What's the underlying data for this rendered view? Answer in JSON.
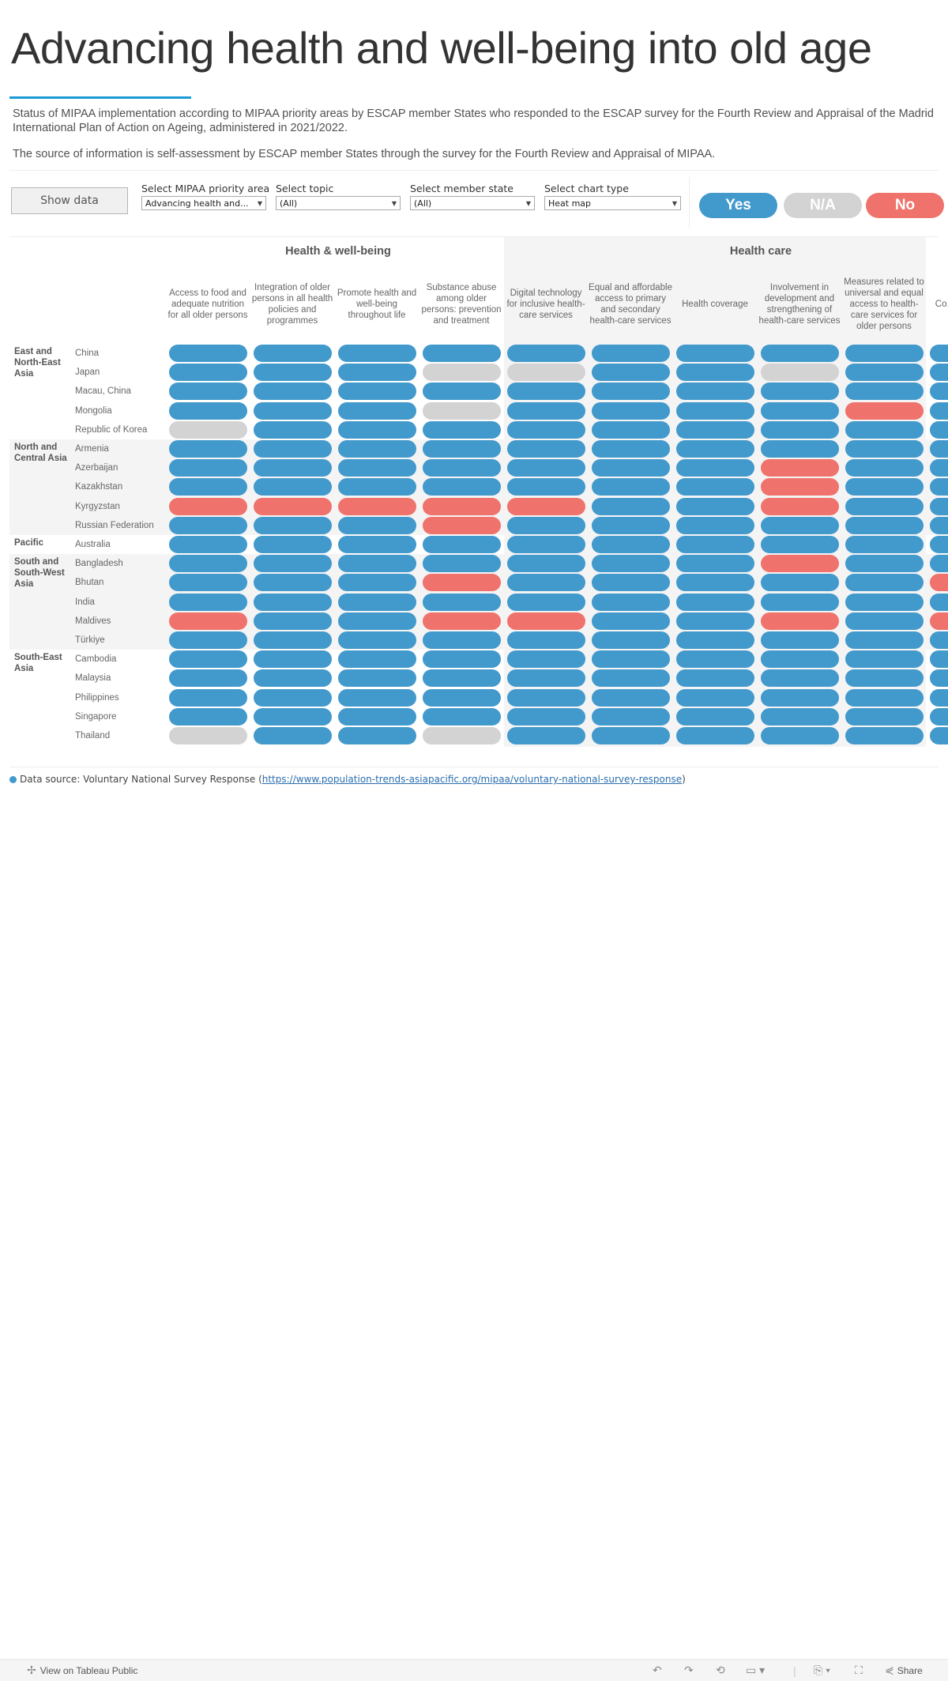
{
  "header": {
    "title": "Advancing health and well-being into old age",
    "description_1": "Status of MIPAA implementation according to MIPAA priority areas by ESCAP member States who responded to the ESCAP survey for the Fourth Review and Appraisal of the Madrid International Plan of Action on Ageing, administered in 2021/2022.",
    "description_2": "The source of information is self-assessment by ESCAP member States through the survey for the Fourth Review and Appraisal of MIPAA."
  },
  "controls": {
    "show_data_label": "Show data",
    "filters": [
      {
        "label": "Select MIPAA priority area",
        "value": "Advancing health and..."
      },
      {
        "label": "Select topic",
        "value": "(All)"
      },
      {
        "label": "Select member state",
        "value": "(All)"
      },
      {
        "label": "Select chart type",
        "value": "Heat map"
      }
    ],
    "legend": {
      "yes": "Yes",
      "na": "N/A",
      "no": "No"
    }
  },
  "colors": {
    "yes": "#4299cc",
    "na": "#d3d3d3",
    "no": "#ef726c",
    "accent": "#1b9ad6"
  },
  "chart_data": {
    "type": "heatmap",
    "value_legend": {
      "Y": "Yes",
      "NA": "N/A",
      "N": "No"
    },
    "groups": [
      {
        "name": "Health & well-being",
        "columns": [
          0,
          1,
          2,
          3
        ]
      },
      {
        "name": "Health care",
        "columns": [
          4,
          5,
          6,
          7,
          8,
          9
        ]
      }
    ],
    "columns": [
      "Access to food and adequate nutrition for all older persons",
      "Integration of older persons in all health policies and programmes",
      "Promote health and well-being throughout life",
      "Substance abuse among older persons: prevention and treatment",
      "Digital technology for inclusive health-care services",
      "Equal and affordable access to primary and secondary health-care services",
      "Health coverage",
      "Involvement  in development and strengthening of health-care services",
      "Measures related to universal and equal access to health-care services for older persons",
      "Co... long... he..."
    ],
    "regions": [
      {
        "name": "East and North-East Asia",
        "countries": [
          "China",
          "Japan",
          "Macau, China",
          "Mongolia",
          "Republic of Korea"
        ]
      },
      {
        "name": "North and Central Asia",
        "countries": [
          "Armenia",
          "Azerbaijan",
          "Kazakhstan",
          "Kyrgyzstan",
          "Russian Federation"
        ]
      },
      {
        "name": "Pacific",
        "countries": [
          "Australia"
        ]
      },
      {
        "name": "South and South-West Asia",
        "countries": [
          "Bangladesh",
          "Bhutan",
          "India",
          "Maldives",
          "Türkiye"
        ]
      },
      {
        "name": "South-East Asia",
        "countries": [
          "Cambodia",
          "Malaysia",
          "Philippines",
          "Singapore",
          "Thailand"
        ]
      }
    ],
    "values": {
      "China": [
        "Y",
        "Y",
        "Y",
        "Y",
        "Y",
        "Y",
        "Y",
        "Y",
        "Y",
        "Y"
      ],
      "Japan": [
        "Y",
        "Y",
        "Y",
        "NA",
        "NA",
        "Y",
        "Y",
        "NA",
        "Y",
        "Y"
      ],
      "Macau, China": [
        "Y",
        "Y",
        "Y",
        "Y",
        "Y",
        "Y",
        "Y",
        "Y",
        "Y",
        "Y"
      ],
      "Mongolia": [
        "Y",
        "Y",
        "Y",
        "NA",
        "Y",
        "Y",
        "Y",
        "Y",
        "N",
        "Y"
      ],
      "Republic of Korea": [
        "NA",
        "Y",
        "Y",
        "Y",
        "Y",
        "Y",
        "Y",
        "Y",
        "Y",
        "Y"
      ],
      "Armenia": [
        "Y",
        "Y",
        "Y",
        "Y",
        "Y",
        "Y",
        "Y",
        "Y",
        "Y",
        "Y"
      ],
      "Azerbaijan": [
        "Y",
        "Y",
        "Y",
        "Y",
        "Y",
        "Y",
        "Y",
        "N",
        "Y",
        "Y"
      ],
      "Kazakhstan": [
        "Y",
        "Y",
        "Y",
        "Y",
        "Y",
        "Y",
        "Y",
        "N",
        "Y",
        "Y"
      ],
      "Kyrgyzstan": [
        "N",
        "N",
        "N",
        "N",
        "N",
        "Y",
        "Y",
        "N",
        "Y",
        "Y"
      ],
      "Russian Federation": [
        "Y",
        "Y",
        "Y",
        "N",
        "Y",
        "Y",
        "Y",
        "Y",
        "Y",
        "Y"
      ],
      "Australia": [
        "Y",
        "Y",
        "Y",
        "Y",
        "Y",
        "Y",
        "Y",
        "Y",
        "Y",
        "Y"
      ],
      "Bangladesh": [
        "Y",
        "Y",
        "Y",
        "Y",
        "Y",
        "Y",
        "Y",
        "N",
        "Y",
        "Y"
      ],
      "Bhutan": [
        "Y",
        "Y",
        "Y",
        "N",
        "Y",
        "Y",
        "Y",
        "Y",
        "Y",
        "N"
      ],
      "India": [
        "Y",
        "Y",
        "Y",
        "Y",
        "Y",
        "Y",
        "Y",
        "Y",
        "Y",
        "Y"
      ],
      "Maldives": [
        "N",
        "Y",
        "Y",
        "N",
        "N",
        "Y",
        "Y",
        "N",
        "Y",
        "N"
      ],
      "Türkiye": [
        "Y",
        "Y",
        "Y",
        "Y",
        "Y",
        "Y",
        "Y",
        "Y",
        "Y",
        "Y"
      ],
      "Cambodia": [
        "Y",
        "Y",
        "Y",
        "Y",
        "Y",
        "Y",
        "Y",
        "Y",
        "Y",
        "Y"
      ],
      "Malaysia": [
        "Y",
        "Y",
        "Y",
        "Y",
        "Y",
        "Y",
        "Y",
        "Y",
        "Y",
        "Y"
      ],
      "Philippines": [
        "Y",
        "Y",
        "Y",
        "Y",
        "Y",
        "Y",
        "Y",
        "Y",
        "Y",
        "Y"
      ],
      "Singapore": [
        "Y",
        "Y",
        "Y",
        "Y",
        "Y",
        "Y",
        "Y",
        "Y",
        "Y",
        "Y"
      ],
      "Thailand": [
        "NA",
        "Y",
        "Y",
        "NA",
        "Y",
        "Y",
        "Y",
        "Y",
        "Y",
        "Y"
      ]
    }
  },
  "footer": {
    "source_prefix": "Data source: Voluntary National Survey Response (",
    "source_link": "https://www.population-trends-asiapacific.org/mipaa/voluntary-national-survey-response",
    "source_suffix": ")"
  },
  "toolbar": {
    "view_on_tableau": "View on Tableau Public",
    "share": "Share"
  }
}
